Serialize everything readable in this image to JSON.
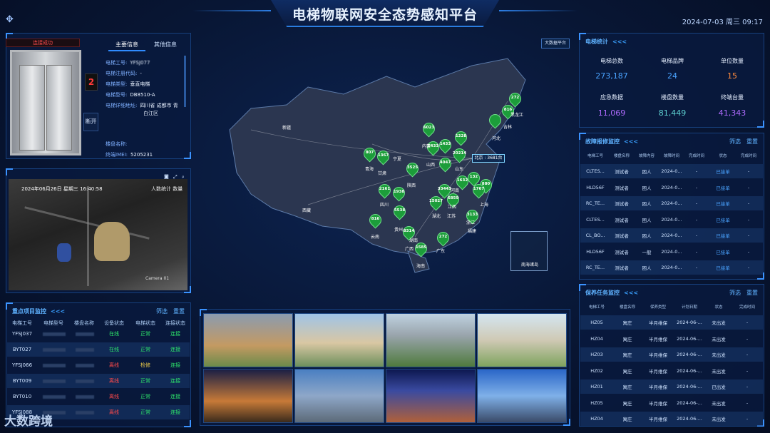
{
  "header": {
    "title": "电梯物联网安全态势感知平台",
    "datetime": "2024-07-03 周三 09:17"
  },
  "elevator_panel": {
    "connection_status": "连接成功",
    "floor": "2",
    "door_button": "断开",
    "tabs": [
      "主要信息",
      "其他信息"
    ],
    "info": [
      {
        "label": "电梯工号:",
        "value": "YFSJ077"
      },
      {
        "label": "电梯注册代码:",
        "value": "-"
      },
      {
        "label": "电梯类型:",
        "value": "垂直电梯"
      },
      {
        "label": "电梯型号:",
        "value": "DB8510-A"
      },
      {
        "label": "电梯详细地址:",
        "value": "四川省 成都市 青"
      },
      {
        "label": "",
        "value": "白江区"
      },
      {
        "label": "楼盘名称:",
        "value": ""
      },
      {
        "label": "终端IMEI:",
        "value": "5205231"
      }
    ]
  },
  "camera": {
    "osd": "2024年06月26日 星期三 16:40:58",
    "people_label": "人数统计  数量",
    "camera_name": "Camera 01"
  },
  "key_projects": {
    "title": "重点项目监控",
    "arrows": "<<<",
    "filter": "筛选",
    "reset": "重置",
    "columns": [
      "电梯工号",
      "电梯型号",
      "楼盘名称",
      "设备状态",
      "电梯状态",
      "连接状态"
    ],
    "rows": [
      {
        "id": "YFSJ037",
        "device": "在线",
        "elevator": "正常",
        "conn": "连接"
      },
      {
        "id": "BYT027",
        "device": "在线",
        "elevator": "正常",
        "conn": "连接"
      },
      {
        "id": "YFSJ066",
        "device": "离线",
        "elevator": "检修",
        "conn": "连接"
      },
      {
        "id": "BYT009",
        "device": "离线",
        "elevator": "正常",
        "conn": "连接"
      },
      {
        "id": "BYT010",
        "device": "离线",
        "elevator": "正常",
        "conn": "连接"
      },
      {
        "id": "YFSJ088",
        "device": "离线",
        "elevator": "正常",
        "conn": "连接"
      }
    ]
  },
  "map": {
    "bigscreen_button": "大数据平台",
    "callout": "北京 : 3681台",
    "nanhai": "南海诸岛",
    "pins": [
      {
        "value": "272"
      },
      {
        "value": "816"
      },
      {
        "value": "1433"
      },
      {
        "value": "6023"
      },
      {
        "value": "1228"
      },
      {
        "value": "1433"
      },
      {
        "value": "20214"
      },
      {
        "value": "807"
      },
      {
        "value": "1367"
      },
      {
        "value": "3525"
      },
      {
        "value": "4047"
      },
      {
        "value": "1632"
      },
      {
        "value": "132"
      },
      {
        "value": "880"
      },
      {
        "value": "1767"
      },
      {
        "value": "2161"
      },
      {
        "value": "1938"
      },
      {
        "value": "33443"
      },
      {
        "value": "15027"
      },
      {
        "value": "6859"
      },
      {
        "value": "5538"
      },
      {
        "value": "3133"
      },
      {
        "value": "816"
      },
      {
        "value": "8314"
      },
      {
        "value": "272"
      },
      {
        "value": "1585"
      },
      {
        "value": ""
      }
    ],
    "provinces": [
      "新疆",
      "西藏",
      "青海",
      "甘肃",
      "宁夏",
      "内蒙",
      "山西",
      "山东",
      "河北",
      "吉林",
      "黑龙江",
      "四川",
      "陕西",
      "湖北",
      "江苏",
      "上海",
      "江西",
      "浙江",
      "福建",
      "湖南",
      "贵州",
      "云南",
      "广西",
      "广东",
      "海南",
      "河南"
    ]
  },
  "elevator_stats": {
    "title": "电梯统计",
    "arrows": "<<<",
    "items": [
      {
        "label": "电梯总数",
        "value": "273,187",
        "color": "#4aa3ff"
      },
      {
        "label": "电梯品牌",
        "value": "24",
        "color": "#4aa3ff"
      },
      {
        "label": "单位数量",
        "value": "15",
        "color": "#ff8a3d"
      },
      {
        "label": "应急数据",
        "value": "11,069",
        "color": "#b06cff"
      },
      {
        "label": "楼盘数量",
        "value": "81,449",
        "color": "#5fd3d3"
      },
      {
        "label": "终端台量",
        "value": "41,343",
        "color": "#b06cff"
      }
    ]
  },
  "fault_monitor": {
    "title": "故障报修监控",
    "arrows": "<<<",
    "filter": "筛选",
    "reset": "重置",
    "columns": [
      "电梯工号",
      "楼盘名称",
      "故障内容",
      "故障时间",
      "完成时间",
      "状态",
      "完成时间"
    ],
    "rows": [
      {
        "id": "CLTES...",
        "estate": "测试者",
        "content": "困人",
        "time": "2024-0...",
        "done": "-",
        "status": "已接单",
        "end": "-"
      },
      {
        "id": "HLD56F",
        "estate": "测试者",
        "content": "困人",
        "time": "2024-0...",
        "done": "-",
        "status": "已接单",
        "end": "-"
      },
      {
        "id": "RC_TE...",
        "estate": "测试者",
        "content": "困人",
        "time": "2024-0...",
        "done": "-",
        "status": "已接单",
        "end": "-"
      },
      {
        "id": "CLTES...",
        "estate": "测试者",
        "content": "困人",
        "time": "2024-0...",
        "done": "-",
        "status": "已接单",
        "end": "-"
      },
      {
        "id": "CL_BO...",
        "estate": "测试者",
        "content": "困人",
        "time": "2024-0...",
        "done": "-",
        "status": "已接单",
        "end": "-"
      },
      {
        "id": "HLD56F",
        "estate": "测试者",
        "content": "一般",
        "time": "2024-0...",
        "done": "-",
        "status": "已接单",
        "end": "-"
      },
      {
        "id": "RC_TE...",
        "estate": "测试者",
        "content": "困人",
        "time": "2024-0...",
        "done": "-",
        "status": "已接单",
        "end": "-"
      }
    ]
  },
  "maintenance": {
    "title": "保养任务监控",
    "arrows": "<<<",
    "filter": "筛选",
    "reset": "重置",
    "columns": [
      "电梯工号",
      "楼盘名称",
      "保养类型",
      "计划日期",
      "状态",
      "完成时间"
    ],
    "rows": [
      {
        "id": "HZ05",
        "estate": "寓庄",
        "type": "半月维保",
        "date": "2024-06-...",
        "status": "未出发",
        "end": "-"
      },
      {
        "id": "HZ04",
        "estate": "寓庄",
        "type": "半月维保",
        "date": "2024-06-...",
        "status": "未出发",
        "end": "-"
      },
      {
        "id": "HZ03",
        "estate": "寓庄",
        "type": "半月维保",
        "date": "2024-06-...",
        "status": "未出发",
        "end": "-"
      },
      {
        "id": "HZ02",
        "estate": "寓庄",
        "type": "半月维保",
        "date": "2024-06-...",
        "status": "未出发",
        "end": "-"
      },
      {
        "id": "HZ01",
        "estate": "寓庄",
        "type": "半月维保",
        "date": "2024-06-...",
        "status": "已出发",
        "end": "-"
      },
      {
        "id": "HZ05",
        "estate": "寓庄",
        "type": "半月维保",
        "date": "2024-06-...",
        "status": "未出发",
        "end": "-"
      },
      {
        "id": "HZ04",
        "estate": "寓庄",
        "type": "半月维保",
        "date": "2024-06-...",
        "status": "未出发",
        "end": "-"
      }
    ]
  },
  "watermark": "大数跨境"
}
